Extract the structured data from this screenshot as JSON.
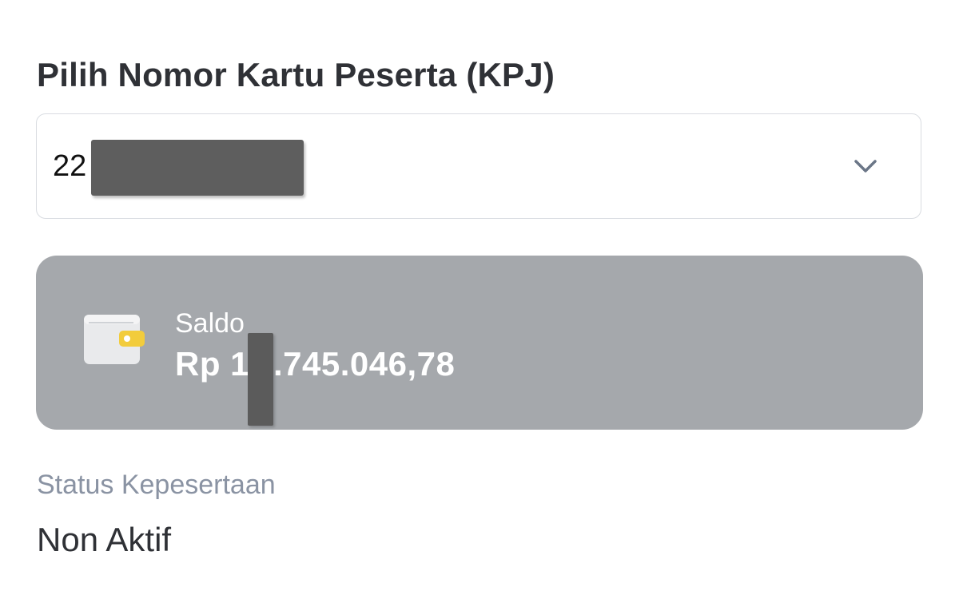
{
  "kpj": {
    "title": "Pilih Nomor Kartu Peserta (KPJ)",
    "selected_value": "22",
    "dropdown_icon": "chevron-down-icon"
  },
  "saldo": {
    "label": "Saldo",
    "value_prefix": "Rp 1",
    "value_suffix": ".745.046,78",
    "icon": "wallet-icon",
    "card_color": "#a5a8ac",
    "icon_accent_color": "#f2cc3c"
  },
  "status": {
    "label": "Status Kepesertaan",
    "value": "Non Aktif"
  }
}
